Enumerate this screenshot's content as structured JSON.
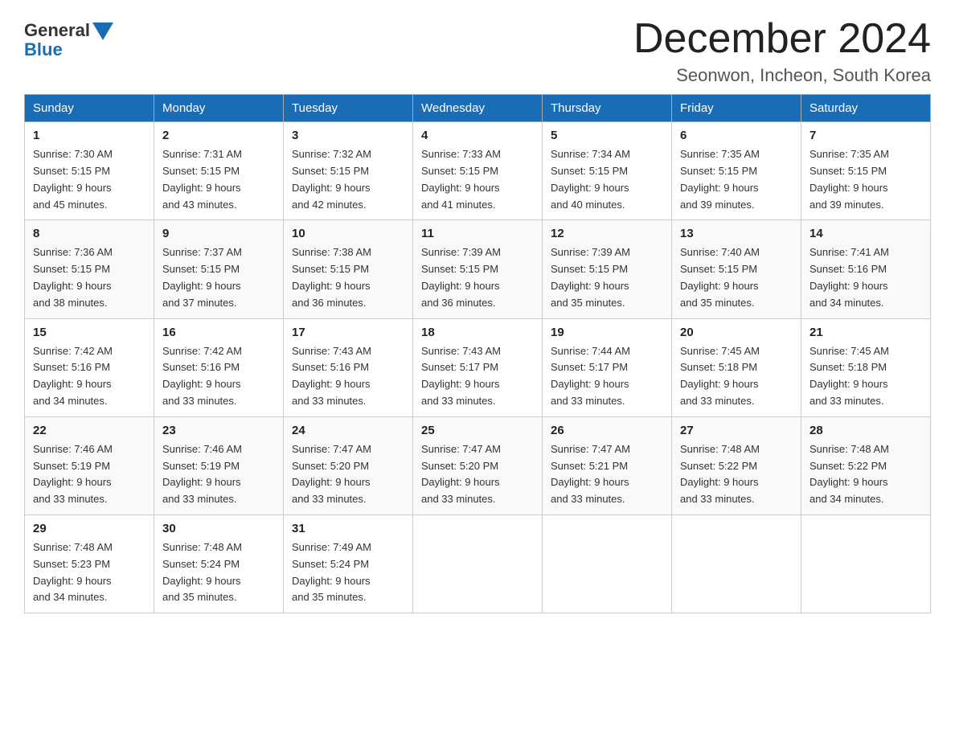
{
  "logo": {
    "general": "General",
    "blue": "Blue"
  },
  "title": "December 2024",
  "location": "Seonwon, Incheon, South Korea",
  "headers": [
    "Sunday",
    "Monday",
    "Tuesday",
    "Wednesday",
    "Thursday",
    "Friday",
    "Saturday"
  ],
  "weeks": [
    [
      {
        "day": "1",
        "sunrise": "7:30 AM",
        "sunset": "5:15 PM",
        "daylight": "9 hours and 45 minutes."
      },
      {
        "day": "2",
        "sunrise": "7:31 AM",
        "sunset": "5:15 PM",
        "daylight": "9 hours and 43 minutes."
      },
      {
        "day": "3",
        "sunrise": "7:32 AM",
        "sunset": "5:15 PM",
        "daylight": "9 hours and 42 minutes."
      },
      {
        "day": "4",
        "sunrise": "7:33 AM",
        "sunset": "5:15 PM",
        "daylight": "9 hours and 41 minutes."
      },
      {
        "day": "5",
        "sunrise": "7:34 AM",
        "sunset": "5:15 PM",
        "daylight": "9 hours and 40 minutes."
      },
      {
        "day": "6",
        "sunrise": "7:35 AM",
        "sunset": "5:15 PM",
        "daylight": "9 hours and 39 minutes."
      },
      {
        "day": "7",
        "sunrise": "7:35 AM",
        "sunset": "5:15 PM",
        "daylight": "9 hours and 39 minutes."
      }
    ],
    [
      {
        "day": "8",
        "sunrise": "7:36 AM",
        "sunset": "5:15 PM",
        "daylight": "9 hours and 38 minutes."
      },
      {
        "day": "9",
        "sunrise": "7:37 AM",
        "sunset": "5:15 PM",
        "daylight": "9 hours and 37 minutes."
      },
      {
        "day": "10",
        "sunrise": "7:38 AM",
        "sunset": "5:15 PM",
        "daylight": "9 hours and 36 minutes."
      },
      {
        "day": "11",
        "sunrise": "7:39 AM",
        "sunset": "5:15 PM",
        "daylight": "9 hours and 36 minutes."
      },
      {
        "day": "12",
        "sunrise": "7:39 AM",
        "sunset": "5:15 PM",
        "daylight": "9 hours and 35 minutes."
      },
      {
        "day": "13",
        "sunrise": "7:40 AM",
        "sunset": "5:15 PM",
        "daylight": "9 hours and 35 minutes."
      },
      {
        "day": "14",
        "sunrise": "7:41 AM",
        "sunset": "5:16 PM",
        "daylight": "9 hours and 34 minutes."
      }
    ],
    [
      {
        "day": "15",
        "sunrise": "7:42 AM",
        "sunset": "5:16 PM",
        "daylight": "9 hours and 34 minutes."
      },
      {
        "day": "16",
        "sunrise": "7:42 AM",
        "sunset": "5:16 PM",
        "daylight": "9 hours and 33 minutes."
      },
      {
        "day": "17",
        "sunrise": "7:43 AM",
        "sunset": "5:16 PM",
        "daylight": "9 hours and 33 minutes."
      },
      {
        "day": "18",
        "sunrise": "7:43 AM",
        "sunset": "5:17 PM",
        "daylight": "9 hours and 33 minutes."
      },
      {
        "day": "19",
        "sunrise": "7:44 AM",
        "sunset": "5:17 PM",
        "daylight": "9 hours and 33 minutes."
      },
      {
        "day": "20",
        "sunrise": "7:45 AM",
        "sunset": "5:18 PM",
        "daylight": "9 hours and 33 minutes."
      },
      {
        "day": "21",
        "sunrise": "7:45 AM",
        "sunset": "5:18 PM",
        "daylight": "9 hours and 33 minutes."
      }
    ],
    [
      {
        "day": "22",
        "sunrise": "7:46 AM",
        "sunset": "5:19 PM",
        "daylight": "9 hours and 33 minutes."
      },
      {
        "day": "23",
        "sunrise": "7:46 AM",
        "sunset": "5:19 PM",
        "daylight": "9 hours and 33 minutes."
      },
      {
        "day": "24",
        "sunrise": "7:47 AM",
        "sunset": "5:20 PM",
        "daylight": "9 hours and 33 minutes."
      },
      {
        "day": "25",
        "sunrise": "7:47 AM",
        "sunset": "5:20 PM",
        "daylight": "9 hours and 33 minutes."
      },
      {
        "day": "26",
        "sunrise": "7:47 AM",
        "sunset": "5:21 PM",
        "daylight": "9 hours and 33 minutes."
      },
      {
        "day": "27",
        "sunrise": "7:48 AM",
        "sunset": "5:22 PM",
        "daylight": "9 hours and 33 minutes."
      },
      {
        "day": "28",
        "sunrise": "7:48 AM",
        "sunset": "5:22 PM",
        "daylight": "9 hours and 34 minutes."
      }
    ],
    [
      {
        "day": "29",
        "sunrise": "7:48 AM",
        "sunset": "5:23 PM",
        "daylight": "9 hours and 34 minutes."
      },
      {
        "day": "30",
        "sunrise": "7:48 AM",
        "sunset": "5:24 PM",
        "daylight": "9 hours and 35 minutes."
      },
      {
        "day": "31",
        "sunrise": "7:49 AM",
        "sunset": "5:24 PM",
        "daylight": "9 hours and 35 minutes."
      },
      null,
      null,
      null,
      null
    ]
  ],
  "labels": {
    "sunrise": "Sunrise:",
    "sunset": "Sunset:",
    "daylight": "Daylight:"
  }
}
